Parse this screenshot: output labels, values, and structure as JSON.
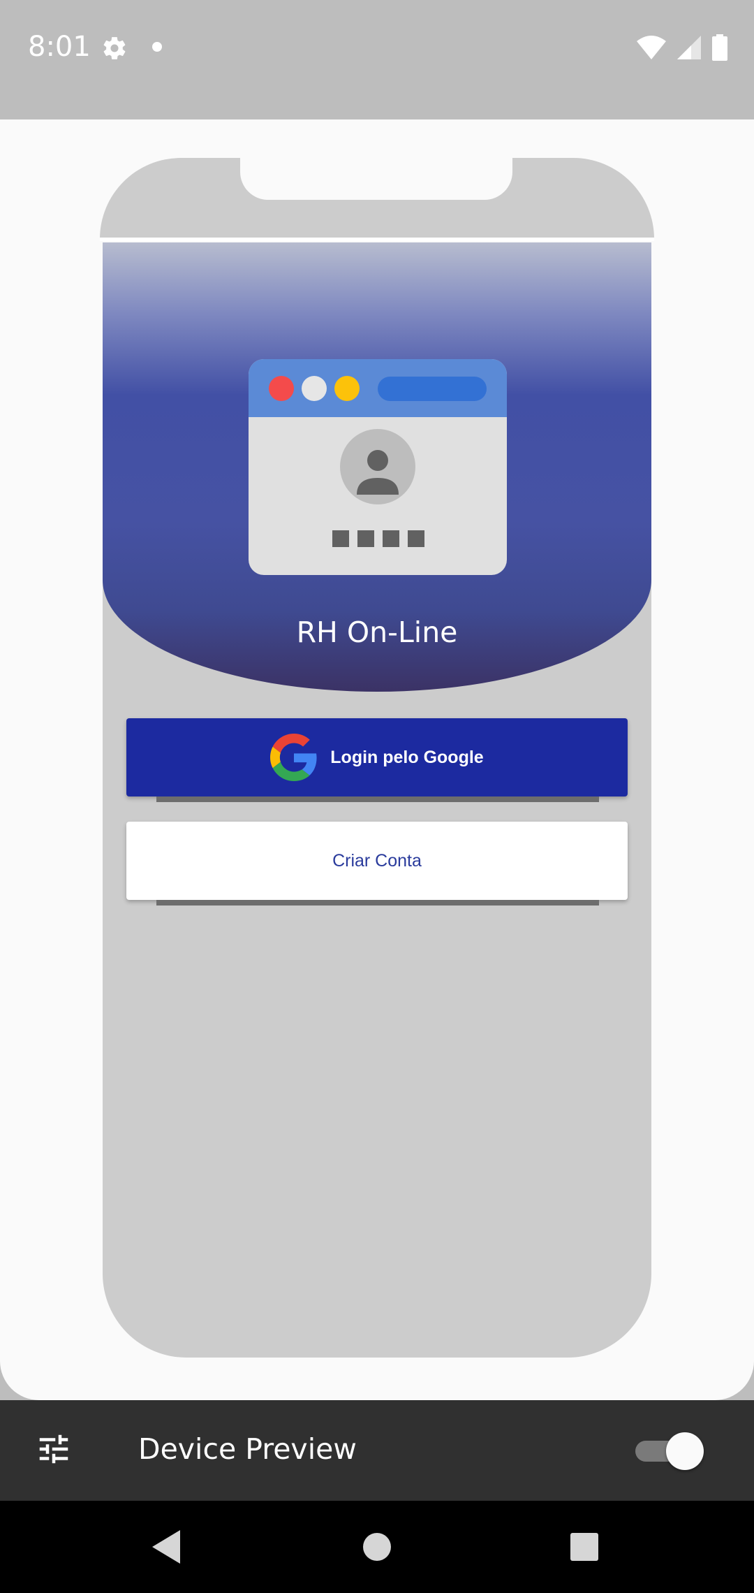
{
  "status_bar": {
    "time": "8:01",
    "icons": [
      "gear-icon",
      "notification-dot-icon",
      "wifi-icon",
      "signal-icon",
      "battery-icon"
    ]
  },
  "app": {
    "title": "RH On-Line",
    "google_button_label": "Login pelo Google",
    "create_account_label": "Criar Conta"
  },
  "toolbar": {
    "title": "Device Preview",
    "settings_icon": "tune-icon",
    "toggle_on": true
  },
  "colors": {
    "primary": "#1c2aa0",
    "header_blue": "#4250a5",
    "toolbar": "#303030"
  }
}
